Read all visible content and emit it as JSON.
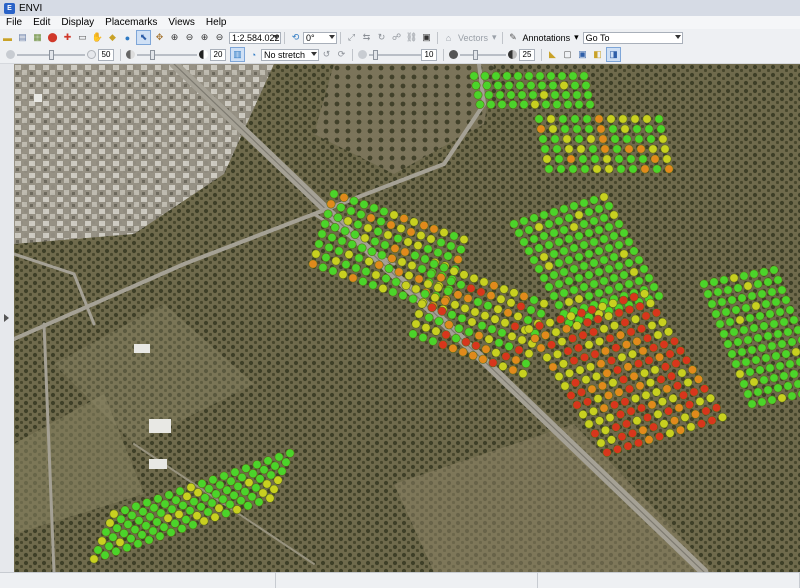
{
  "window": {
    "title": "ENVI",
    "app_icon": "envi-app-icon"
  },
  "menu": [
    {
      "label": "File"
    },
    {
      "label": "Edit"
    },
    {
      "label": "Display"
    },
    {
      "label": "Placemarks"
    },
    {
      "label": "Views"
    },
    {
      "label": "Help"
    }
  ],
  "toolbar1": {
    "scale_value": "1:2.584.022",
    "rotation_value": "0°",
    "vectors_label": "Vectors",
    "annotations_label": "Annotations",
    "goto_value": "Go To"
  },
  "toolbar2": {
    "brightness_value": "50",
    "contrast_value": "20",
    "stretch_value": "No stretch",
    "sharpen_value": "10",
    "transparency_value": "25"
  },
  "colors": {
    "ground": "#6e6a4f",
    "points_green": "#4bd42a",
    "points_yellow": "#c8d020",
    "points_orange": "#e08a1c",
    "points_red": "#d8361c"
  }
}
